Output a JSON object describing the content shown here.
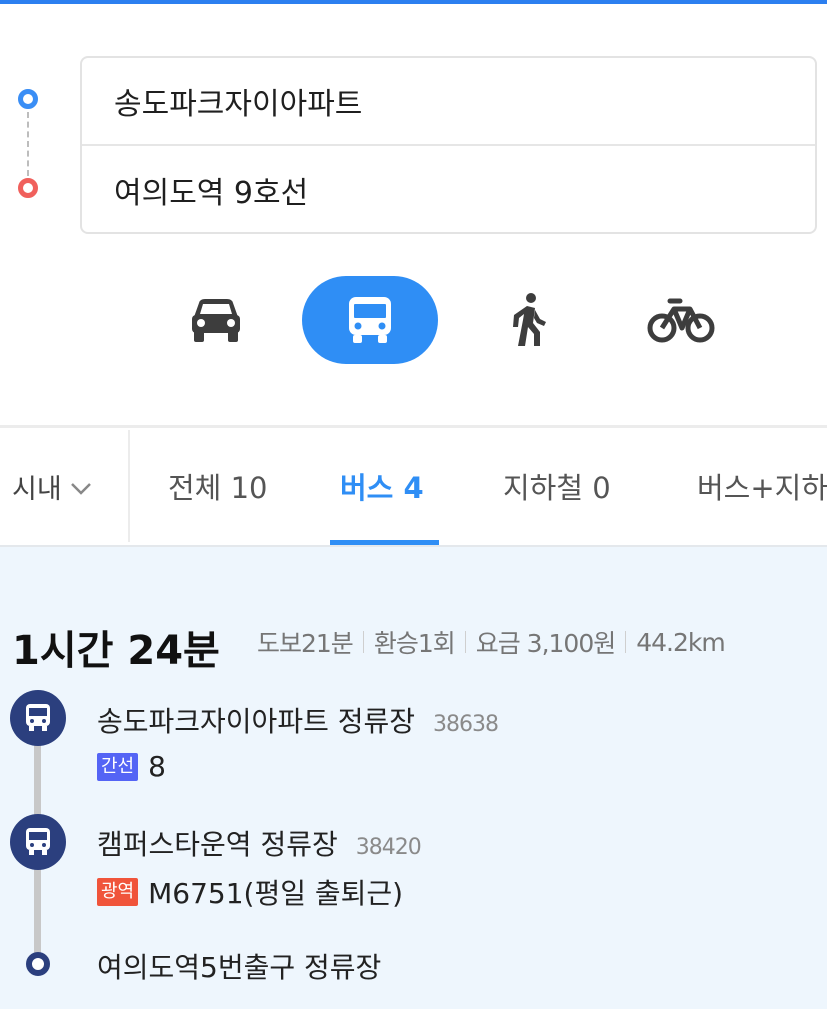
{
  "route": {
    "origin": "송도파크자이아파트",
    "destination": "여의도역 9호선"
  },
  "modes": {
    "car_icon": "car-icon",
    "bus_icon": "bus-icon",
    "walk_icon": "walk-icon",
    "bike_icon": "bike-icon",
    "active": "bus",
    "accent": "#2f8ef5"
  },
  "filter": {
    "region": "시내",
    "icon": "chevron-down-icon"
  },
  "tabs": [
    {
      "label": "전체 10"
    },
    {
      "label": "버스 4"
    },
    {
      "label": "지하철 0"
    },
    {
      "label": "버스+지하"
    }
  ],
  "result": {
    "total_time": "1시간 24분",
    "walk": "도보21분",
    "transfers": "환승1회",
    "fare": "요금 3,100원",
    "distance": "44.2km"
  },
  "itinerary": {
    "stops": [
      {
        "name": "송도파크자이아파트 정류장",
        "code": "38638",
        "badge": "간선",
        "route": "8"
      },
      {
        "name": "캠퍼스타운역 정류장",
        "code": "38420",
        "badge": "광역",
        "route": "M6751(평일 출퇴근)"
      },
      {
        "name": "여의도역5번출구 정류장"
      }
    ],
    "colors": {
      "trunk": "#5464f5",
      "wide_area": "#f0543b",
      "stop": "#2b3f7e"
    }
  }
}
